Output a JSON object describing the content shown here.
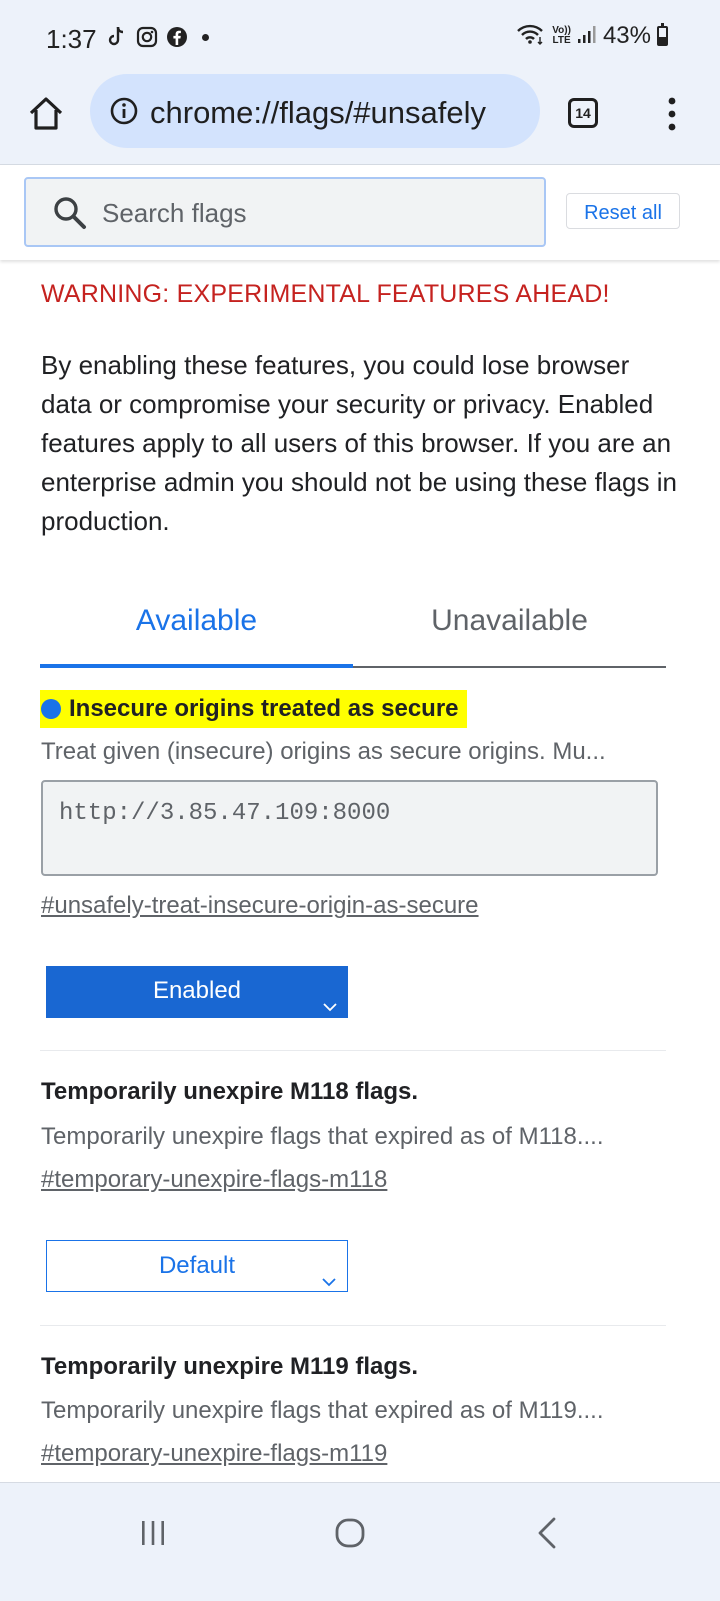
{
  "status_bar": {
    "time": "1:37",
    "app_icons": [
      "tiktok-icon",
      "instagram-icon",
      "facebook-icon"
    ],
    "network_label_top": "Vo))",
    "network_label_bottom": "LTE",
    "battery_percent": "43%",
    "battery_level": 0.43
  },
  "toolbar": {
    "url": "chrome://flags/#unsafely",
    "tab_count": "14"
  },
  "search": {
    "placeholder": "Search flags",
    "reset_label": "Reset all"
  },
  "warning": "WARNING: EXPERIMENTAL FEATURES AHEAD!",
  "intro": "By enabling these features, you could lose browser data or compromise your security or privacy. Enabled features apply to all users of this browser. If you are an enterprise admin you should not be using these flags in production.",
  "tabs": {
    "available": "Available",
    "unavailable": "Unavailable"
  },
  "flags": [
    {
      "title": "Insecure origins treated as secure",
      "description": "Treat given (insecure) origins as secure origins. Mu...",
      "origins_value": "http://3.85.47.109:8000",
      "link": "#unsafely-treat-insecure-origin-as-secure",
      "state": "Enabled",
      "highlighted": true
    },
    {
      "title": "Temporarily unexpire M118 flags.",
      "description": "Temporarily unexpire flags that expired as of M118....",
      "link": "#temporary-unexpire-flags-m118",
      "state": "Default"
    },
    {
      "title": "Temporarily unexpire M119 flags.",
      "description": "Temporarily unexpire flags that expired as of M119....",
      "link": "#temporary-unexpire-flags-m119"
    }
  ],
  "colors": {
    "accent": "#1a73e8",
    "warning": "#c5221f",
    "highlight": "#ffff00",
    "toolbar_bg": "#edf2fa",
    "urlbar_bg": "#d3e3fd"
  },
  "nav_icons": [
    "recent-apps-icon",
    "home-circle-icon",
    "back-icon"
  ]
}
